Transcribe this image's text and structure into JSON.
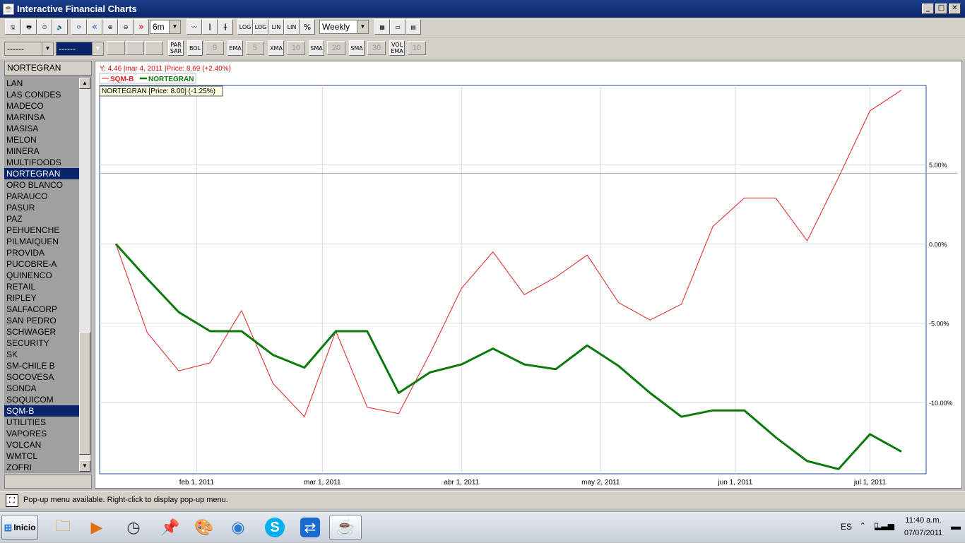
{
  "window": {
    "title": "Interactive Financial Charts"
  },
  "toolbar1": {
    "period": "6m",
    "interval": "Weekly",
    "log1": "LOG",
    "log2": "LOG",
    "lin1": "LIN",
    "lin2": "LIN",
    "pct": "%"
  },
  "toolbar2": {
    "combo1": "------",
    "combo2": "------",
    "par_sar": "PAR SAR",
    "bol": "BOL",
    "bol_val": "9",
    "ema": "EMA",
    "ema_val": "5",
    "xma": "XMA",
    "xma_val": "10",
    "sma2": "SMA",
    "sma2_val": "20",
    "sma3": "SMA",
    "sma3_val": "30",
    "vol": "VOL EMA",
    "vol_val": "10"
  },
  "sidebar": {
    "search_value": "NORTEGRAN",
    "items": [
      "LAN",
      "LAS CONDES",
      "MADECO",
      "MARINSA",
      "MASISA",
      "MELON",
      "MINERA",
      "MULTIFOODS",
      "NORTEGRAN",
      "ORO BLANCO",
      "PARAUCO",
      "PASUR",
      "PAZ",
      "PEHUENCHE",
      "PILMAIQUEN",
      "PROVIDA",
      "PUCOBRE-A",
      "QUINENCO",
      "RETAIL",
      "RIPLEY",
      "SALFACORP",
      "SAN PEDRO",
      "SCHWAGER",
      "SECURITY",
      "SK",
      "SM-CHILE B",
      "SOCOVESA",
      "SONDA",
      "SOQUICOM",
      "SQM-B",
      "UTILITIES",
      "VAPORES",
      "VOLCAN",
      "WMTCL",
      "ZOFRI"
    ],
    "selected": [
      "NORTEGRAN",
      "SQM-B"
    ]
  },
  "chart_data": {
    "type": "line",
    "info_line": "Y: 4.46 |mar 4, 2011 |Price: 8.69 (+2.40%)",
    "tooltip": "NORTEGRAN [Price: 8.00] (-1.25%)",
    "x_ticks": [
      "feb 1, 2011",
      "mar 1, 2011",
      "abr 1, 2011",
      "may 2, 2011",
      "jun 1, 2011",
      "jul 1, 2011"
    ],
    "y_ticks": [
      "5.00%",
      "0.00%",
      "-5.00%",
      "-10.00%"
    ],
    "ylim": [
      -14.5,
      10
    ],
    "horizontal_reference": 4.46,
    "x": [
      "2011-01-14",
      "2011-01-21",
      "2011-01-28",
      "2011-02-04",
      "2011-02-11",
      "2011-02-18",
      "2011-02-25",
      "2011-03-04",
      "2011-03-11",
      "2011-03-18",
      "2011-03-25",
      "2011-04-01",
      "2011-04-08",
      "2011-04-15",
      "2011-04-22",
      "2011-04-29",
      "2011-05-06",
      "2011-05-13",
      "2011-05-20",
      "2011-05-27",
      "2011-06-03",
      "2011-06-10",
      "2011-06-17",
      "2011-06-24",
      "2011-07-01",
      "2011-07-08"
    ],
    "series": [
      {
        "name": "SQM-B",
        "color": "#e02020",
        "values": [
          0.0,
          -5.6,
          -8.0,
          -7.5,
          -4.2,
          -8.8,
          -10.9,
          -5.5,
          -10.3,
          -10.7,
          -6.9,
          -2.8,
          -0.5,
          -3.2,
          -2.1,
          -0.7,
          -3.7,
          -4.8,
          -3.8,
          1.1,
          2.9,
          2.9,
          0.2,
          4.2,
          8.4,
          9.7
        ]
      },
      {
        "name": "NORTEGRAN",
        "color": "#0a7a0a",
        "values": [
          0.0,
          -2.2,
          -4.3,
          -5.5,
          -5.5,
          -7.0,
          -7.8,
          -5.5,
          -5.5,
          -9.4,
          -8.1,
          -7.6,
          -6.6,
          -7.6,
          -7.9,
          -6.4,
          -7.7,
          -9.4,
          -10.9,
          -10.5,
          -10.5,
          -12.2,
          -13.7,
          -14.2,
          -12.0,
          -13.1
        ]
      }
    ]
  },
  "statusbar": {
    "message": "Pop-up menu available. Right-click to display pop-up menu."
  },
  "taskbar": {
    "start": "Inicio",
    "lang": "ES",
    "time": "11:40 a.m.",
    "date": "07/07/2011"
  }
}
